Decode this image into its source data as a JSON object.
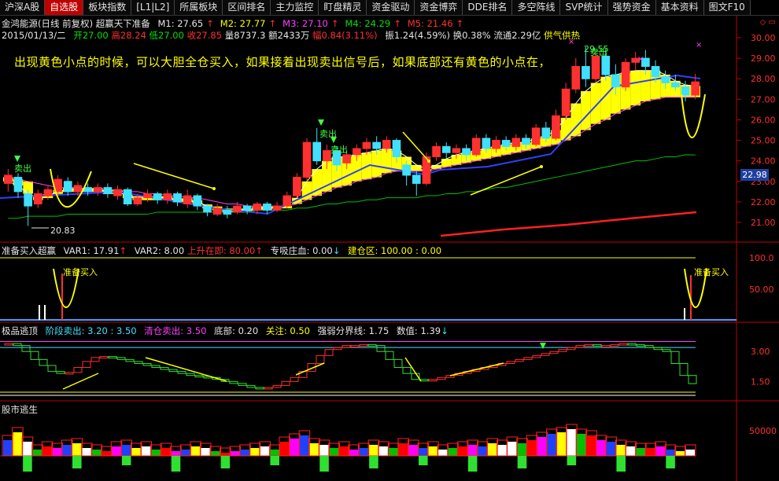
{
  "tabs": [
    {
      "label": "沪深A股",
      "active": false
    },
    {
      "label": "自选股",
      "active": true
    },
    {
      "label": "板块指数",
      "active": false
    },
    {
      "label": "[L1|L2]",
      "active": false
    },
    {
      "label": "所属板块",
      "active": false
    },
    {
      "label": "区间排名",
      "active": false
    },
    {
      "label": "主力监控",
      "active": false
    },
    {
      "label": "盯盘精灵",
      "active": false
    },
    {
      "label": "资金驱动",
      "active": false
    },
    {
      "label": "资金博弈",
      "active": false
    },
    {
      "label": "DDE排名",
      "active": false
    },
    {
      "label": "多空阵线",
      "active": false
    },
    {
      "label": "SVP统计",
      "active": false
    },
    {
      "label": "强势资金",
      "active": false
    },
    {
      "label": "基本资料",
      "active": false
    },
    {
      "label": "图文F10",
      "active": false
    }
  ],
  "header": {
    "stock": "金鸿能源(日线 前复权) 超赢天下准备",
    "ma": [
      {
        "label": "M1: 27.65",
        "color": "white"
      },
      {
        "label": "M2: 27.77",
        "color": "yellow"
      },
      {
        "label": "M3: 27.10",
        "color": "magenta"
      },
      {
        "label": "M4: 24.29",
        "color": "green"
      },
      {
        "label": "M5: 21.46",
        "color": "red"
      }
    ],
    "quote": {
      "date": "2015/01/13/二",
      "open": "开27.00",
      "high": "高28.24",
      "low": "低27.00",
      "close": "收27.85",
      "volume": "量8737.3",
      "amount": "额2433万",
      "change": "幅0.84(3.11%)",
      "amplitude": "振1.24(4.59%)",
      "turnover": "换0.38%",
      "float": "流通2.29亿",
      "flag": "供气供热"
    }
  },
  "annotation": "出现黄色小点的时候，可以大胆全仓买入，如果接着出现卖出信号后，如果底部还有黄色的小点在，",
  "signals": {
    "sell": "卖出",
    "prepare_buy": "准备买入",
    "peak_price": "29.55",
    "low_price": "20.83",
    "current_price": "22.98"
  },
  "price_axis": [
    "30.00",
    "29.00",
    "28.00",
    "27.00",
    "26.00",
    "25.00",
    "24.00",
    "23.00",
    "22.00",
    "21.00"
  ],
  "indicator1": {
    "title": "准备买入超赢",
    "var1": "VAR1: 17.91",
    "var2": "VAR2: 8.00",
    "rising": "上升在即: 80.00",
    "absorb": "专吸庄血: 0.00",
    "build": "建仓区: 100.00 : 0.00",
    "axis": [
      "100.0",
      "50.00"
    ]
  },
  "indicator2": {
    "title": "极品逃顶",
    "stage_sell": "阶段卖出: 3.20 : 3.50",
    "clear_sell": "清仓卖出: 3.50",
    "bottom": "底部: 0.20",
    "focus": "关注: 0.50",
    "divide": "强弱分界线: 1.75",
    "value": "数值: 1.39",
    "axis": [
      "3.00",
      "1.50"
    ]
  },
  "indicator3": {
    "title": "股市逃生",
    "axis": [
      "50000"
    ]
  },
  "chart_data": {
    "type": "candlestick",
    "y_axis": [
      21,
      30
    ],
    "candles": [
      {
        "o": 22.9,
        "c": 23.3,
        "h": 23.6,
        "l": 22.5
      },
      {
        "o": 23.2,
        "c": 22.5,
        "h": 23.4,
        "l": 22.2
      },
      {
        "o": 22.4,
        "c": 21.8,
        "h": 22.6,
        "l": 20.83
      },
      {
        "o": 21.9,
        "c": 22.4,
        "h": 22.6,
        "l": 21.7
      },
      {
        "o": 22.3,
        "c": 22.6,
        "h": 22.8,
        "l": 22.1
      },
      {
        "o": 22.5,
        "c": 23.1,
        "h": 23.3,
        "l": 22.3
      },
      {
        "o": 23.0,
        "c": 22.5,
        "h": 23.2,
        "l": 22.3
      },
      {
        "o": 22.5,
        "c": 22.8,
        "h": 23.0,
        "l": 22.3
      },
      {
        "o": 22.7,
        "c": 22.5,
        "h": 22.9,
        "l": 22.3
      },
      {
        "o": 22.5,
        "c": 22.7,
        "h": 22.9,
        "l": 22.3
      },
      {
        "o": 22.7,
        "c": 22.4,
        "h": 22.9,
        "l": 22.2
      },
      {
        "o": 22.3,
        "c": 22.6,
        "h": 22.8,
        "l": 22.1
      },
      {
        "o": 22.6,
        "c": 21.9,
        "h": 22.7,
        "l": 21.8
      },
      {
        "o": 21.9,
        "c": 22.2,
        "h": 22.4,
        "l": 21.8
      },
      {
        "o": 22.2,
        "c": 22.4,
        "h": 22.6,
        "l": 22.0
      },
      {
        "o": 22.4,
        "c": 22.1,
        "h": 22.5,
        "l": 21.9
      },
      {
        "o": 22.1,
        "c": 22.4,
        "h": 22.6,
        "l": 21.9
      },
      {
        "o": 22.4,
        "c": 22.0,
        "h": 22.5,
        "l": 21.8
      },
      {
        "o": 21.9,
        "c": 22.3,
        "h": 22.6,
        "l": 21.7
      },
      {
        "o": 22.3,
        "c": 21.8,
        "h": 22.4,
        "l": 21.6
      },
      {
        "o": 21.8,
        "c": 21.5,
        "h": 21.9,
        "l": 21.3
      },
      {
        "o": 21.4,
        "c": 21.7,
        "h": 21.9,
        "l": 21.3
      },
      {
        "o": 21.6,
        "c": 21.4,
        "h": 21.8,
        "l": 21.2
      },
      {
        "o": 21.5,
        "c": 21.8,
        "h": 22.0,
        "l": 21.4
      },
      {
        "o": 21.8,
        "c": 21.6,
        "h": 21.9,
        "l": 21.4
      },
      {
        "o": 21.6,
        "c": 21.9,
        "h": 22.0,
        "l": 21.4
      },
      {
        "o": 21.9,
        "c": 21.6,
        "h": 22.0,
        "l": 21.4
      },
      {
        "o": 21.6,
        "c": 21.8,
        "h": 22.0,
        "l": 21.5
      },
      {
        "o": 21.8,
        "c": 22.3,
        "h": 22.5,
        "l": 21.7
      },
      {
        "o": 22.3,
        "c": 23.2,
        "h": 23.4,
        "l": 22.2
      },
      {
        "o": 23.2,
        "c": 24.9,
        "h": 25.1,
        "l": 23.0
      },
      {
        "o": 24.9,
        "c": 24.0,
        "h": 25.6,
        "l": 23.8
      },
      {
        "o": 24.0,
        "c": 24.5,
        "h": 24.8,
        "l": 23.6
      },
      {
        "o": 24.5,
        "c": 23.8,
        "h": 24.7,
        "l": 23.5
      },
      {
        "o": 23.9,
        "c": 24.3,
        "h": 24.5,
        "l": 23.6
      },
      {
        "o": 24.3,
        "c": 24.6,
        "h": 24.8,
        "l": 24.0
      },
      {
        "o": 24.6,
        "c": 24.9,
        "h": 25.1,
        "l": 24.3
      },
      {
        "o": 24.9,
        "c": 24.6,
        "h": 25.2,
        "l": 24.3
      },
      {
        "o": 24.6,
        "c": 25.0,
        "h": 25.2,
        "l": 24.4
      },
      {
        "o": 25.0,
        "c": 24.2,
        "h": 25.1,
        "l": 23.9
      },
      {
        "o": 23.8,
        "c": 23.3,
        "h": 24.0,
        "l": 22.8
      },
      {
        "o": 23.3,
        "c": 22.9,
        "h": 23.5,
        "l": 22.3
      },
      {
        "o": 22.9,
        "c": 24.2,
        "h": 24.4,
        "l": 22.8
      },
      {
        "o": 24.2,
        "c": 24.7,
        "h": 24.9,
        "l": 24.0
      },
      {
        "o": 24.7,
        "c": 24.4,
        "h": 24.9,
        "l": 24.1
      },
      {
        "o": 24.4,
        "c": 24.6,
        "h": 24.8,
        "l": 24.1
      },
      {
        "o": 24.6,
        "c": 24.3,
        "h": 24.8,
        "l": 24.0
      },
      {
        "o": 24.3,
        "c": 25.1,
        "h": 25.3,
        "l": 24.2
      },
      {
        "o": 25.1,
        "c": 24.6,
        "h": 25.3,
        "l": 24.4
      },
      {
        "o": 24.6,
        "c": 25.0,
        "h": 25.2,
        "l": 24.4
      },
      {
        "o": 25.0,
        "c": 24.7,
        "h": 25.2,
        "l": 24.5
      },
      {
        "o": 24.7,
        "c": 25.1,
        "h": 25.3,
        "l": 24.5
      },
      {
        "o": 25.1,
        "c": 24.8,
        "h": 25.3,
        "l": 24.6
      },
      {
        "o": 24.8,
        "c": 25.6,
        "h": 25.8,
        "l": 24.7
      },
      {
        "o": 25.6,
        "c": 25.1,
        "h": 25.9,
        "l": 24.9
      },
      {
        "o": 25.1,
        "c": 26.2,
        "h": 26.5,
        "l": 25.0
      },
      {
        "o": 26.2,
        "c": 27.5,
        "h": 27.8,
        "l": 26.0
      },
      {
        "o": 27.5,
        "c": 28.6,
        "h": 29.0,
        "l": 27.3
      },
      {
        "o": 28.6,
        "c": 28.0,
        "h": 29.55,
        "l": 27.6
      },
      {
        "o": 28.0,
        "c": 29.1,
        "h": 29.3,
        "l": 27.8
      },
      {
        "o": 29.1,
        "c": 28.2,
        "h": 29.4,
        "l": 27.9
      },
      {
        "o": 28.2,
        "c": 27.6,
        "h": 28.7,
        "l": 27.2
      },
      {
        "o": 27.6,
        "c": 28.8,
        "h": 29.0,
        "l": 27.4
      },
      {
        "o": 28.8,
        "c": 29.0,
        "h": 29.3,
        "l": 28.4
      },
      {
        "o": 29.0,
        "c": 28.6,
        "h": 29.4,
        "l": 28.2
      },
      {
        "o": 28.6,
        "c": 28.1,
        "h": 28.9,
        "l": 27.8
      },
      {
        "o": 28.1,
        "c": 27.8,
        "h": 28.4,
        "l": 27.5
      },
      {
        "o": 27.8,
        "c": 27.6,
        "h": 28.2,
        "l": 27.4
      },
      {
        "o": 27.6,
        "c": 27.2,
        "h": 27.9,
        "l": 26.9
      },
      {
        "o": 27.2,
        "c": 27.85,
        "h": 28.24,
        "l": 27.0
      }
    ],
    "ma_short": [
      23.0,
      22.8,
      22.4,
      22.2,
      22.3,
      22.5,
      22.6,
      22.6,
      22.6,
      22.6,
      22.5,
      22.5,
      22.3,
      22.2,
      22.2,
      22.2,
      22.2,
      22.1,
      22.1,
      22.0,
      21.8,
      21.7,
      21.6,
      21.6,
      21.6,
      21.7,
      21.7,
      21.7,
      21.8,
      22.2,
      23.0,
      23.6,
      24.0,
      24.2,
      24.2,
      24.3,
      24.4,
      24.5,
      24.6,
      24.5,
      24.2,
      23.8,
      23.6,
      23.8,
      24.1,
      24.3,
      24.4,
      24.5,
      24.6,
      24.7,
      24.8,
      24.9,
      24.9,
      25.1,
      25.2,
      25.5,
      26.1,
      26.8,
      27.4,
      27.8,
      28.1,
      28.2,
      28.3,
      28.4,
      28.4,
      28.4,
      28.2,
      27.9,
      27.7,
      27.65
    ],
    "ma_long": [
      23.2,
      23.1,
      23.0,
      22.9,
      22.8,
      22.7,
      22.7,
      22.7,
      22.6,
      22.6,
      22.6,
      22.6,
      22.5,
      22.5,
      22.4,
      22.4,
      22.3,
      22.3,
      22.2,
      22.2,
      22.1,
      22.0,
      21.9,
      21.9,
      21.8,
      21.8,
      21.8,
      21.8,
      21.8,
      21.9,
      22.1,
      22.3,
      22.5,
      22.7,
      22.8,
      23.0,
      23.1,
      23.2,
      23.4,
      23.5,
      23.5,
      23.5,
      23.5,
      23.6,
      23.7,
      23.8,
      23.9,
      24.0,
      24.1,
      24.2,
      24.3,
      24.4,
      24.5,
      24.6,
      24.7,
      24.8,
      25.0,
      25.2,
      25.5,
      25.8,
      26.0,
      26.3,
      26.5,
      26.7,
      26.9,
      27.0,
      27.1,
      27.1,
      27.1,
      27.1
    ],
    "ma_60": [
      21.2,
      21.2,
      21.3,
      21.3,
      21.3,
      21.3,
      21.4,
      21.4,
      21.4,
      21.4,
      21.4,
      21.4,
      21.4,
      21.4,
      21.4,
      21.5,
      21.5,
      21.5,
      21.5,
      21.5,
      21.5,
      21.5,
      21.5,
      21.5,
      21.5,
      21.6,
      21.6,
      21.6,
      21.6,
      21.7,
      21.7,
      21.8,
      21.9,
      21.9,
      22.0,
      22.0,
      22.1,
      22.1,
      22.2,
      22.2,
      22.2,
      22.2,
      22.3,
      22.3,
      22.4,
      22.4,
      22.5,
      22.5,
      22.6,
      22.7,
      22.7,
      22.8,
      22.9,
      23.0,
      23.1,
      23.2,
      23.3,
      23.4,
      23.5,
      23.6,
      23.7,
      23.8,
      23.9,
      24.0,
      24.0,
      24.1,
      24.2,
      24.2,
      24.3,
      24.29
    ]
  }
}
